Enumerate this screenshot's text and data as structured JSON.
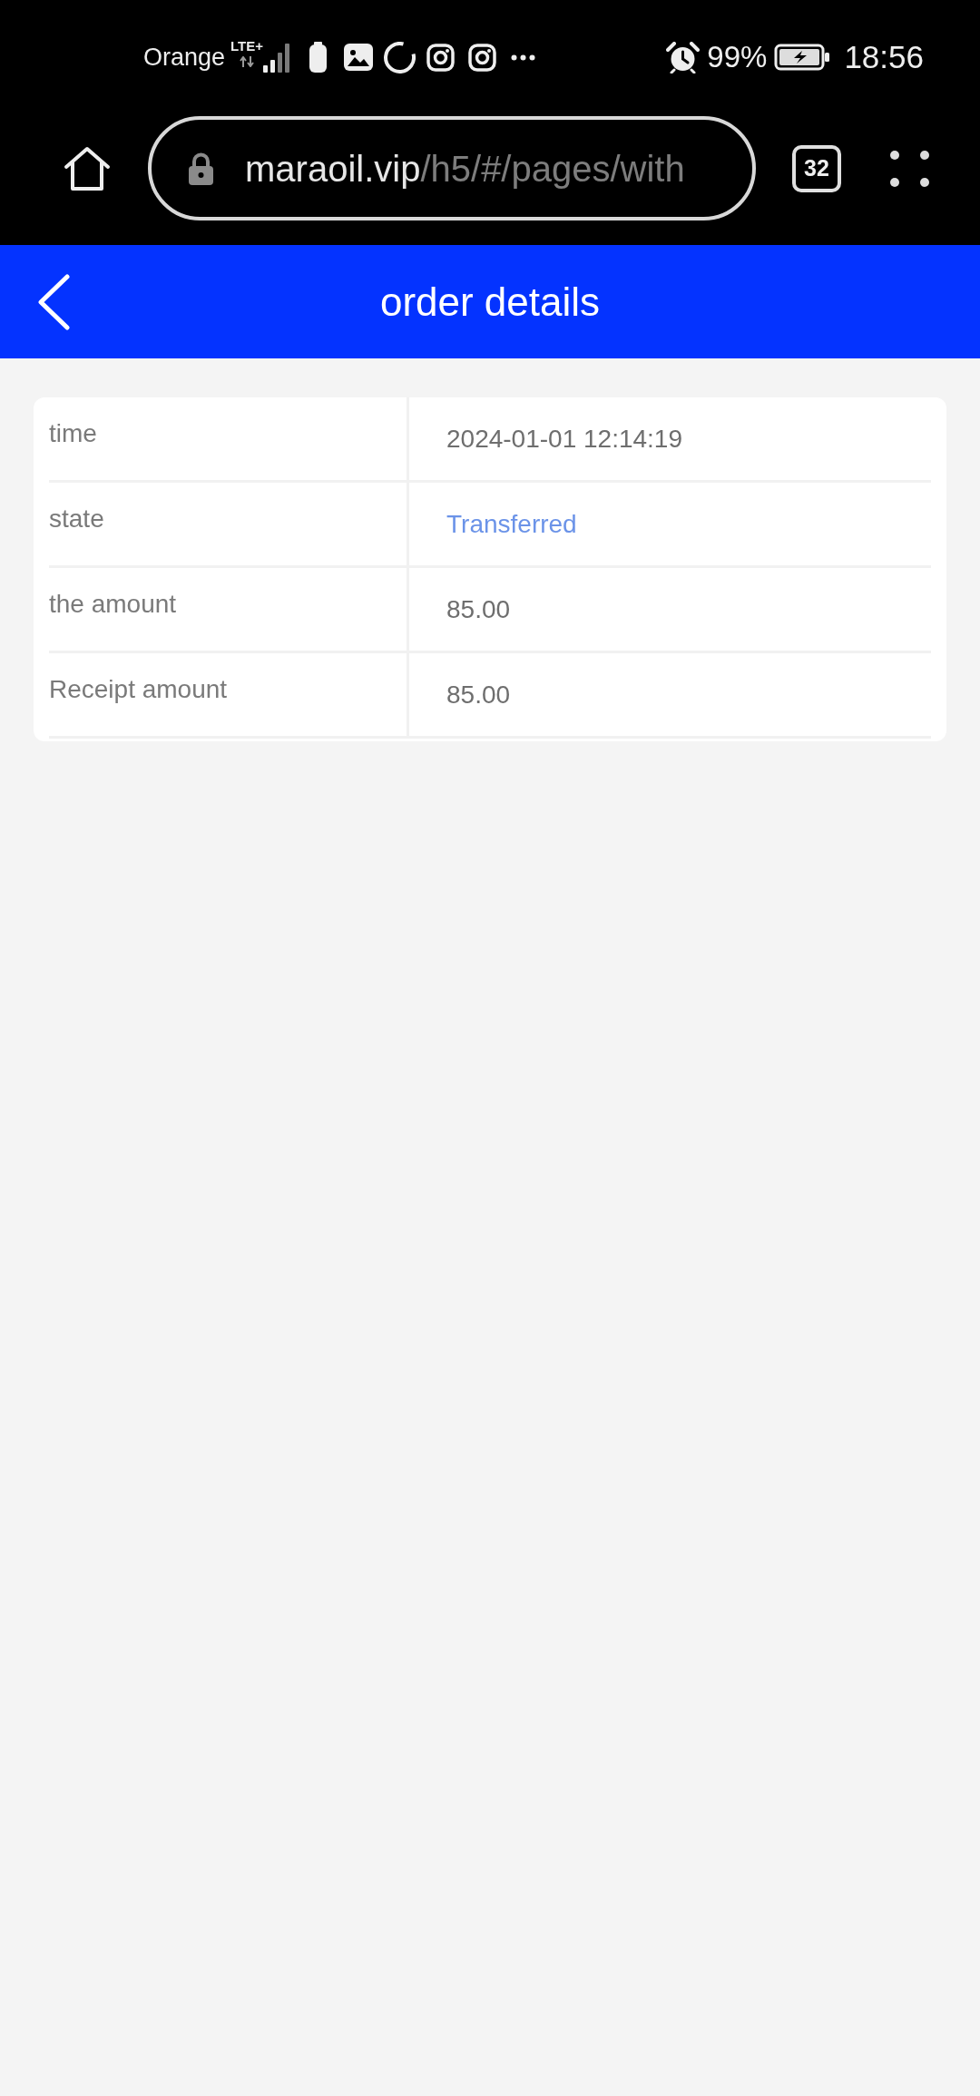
{
  "status_bar": {
    "carrier": "Orange",
    "network": "LTE+",
    "battery": "99%",
    "time": "18:56"
  },
  "browser_bar": {
    "url_host": "maraoil.vip",
    "url_path": "/h5/#/pages/with",
    "tab_count": "32"
  },
  "header": {
    "title": "order details"
  },
  "details": [
    {
      "label": "time",
      "value": "2024-01-01 12:14:19",
      "kind": "text"
    },
    {
      "label": "state",
      "value": "Transferred",
      "kind": "status"
    },
    {
      "label": "the amount",
      "value": "85.00",
      "kind": "text"
    },
    {
      "label": "Receipt amount",
      "value": "85.00",
      "kind": "text"
    }
  ]
}
